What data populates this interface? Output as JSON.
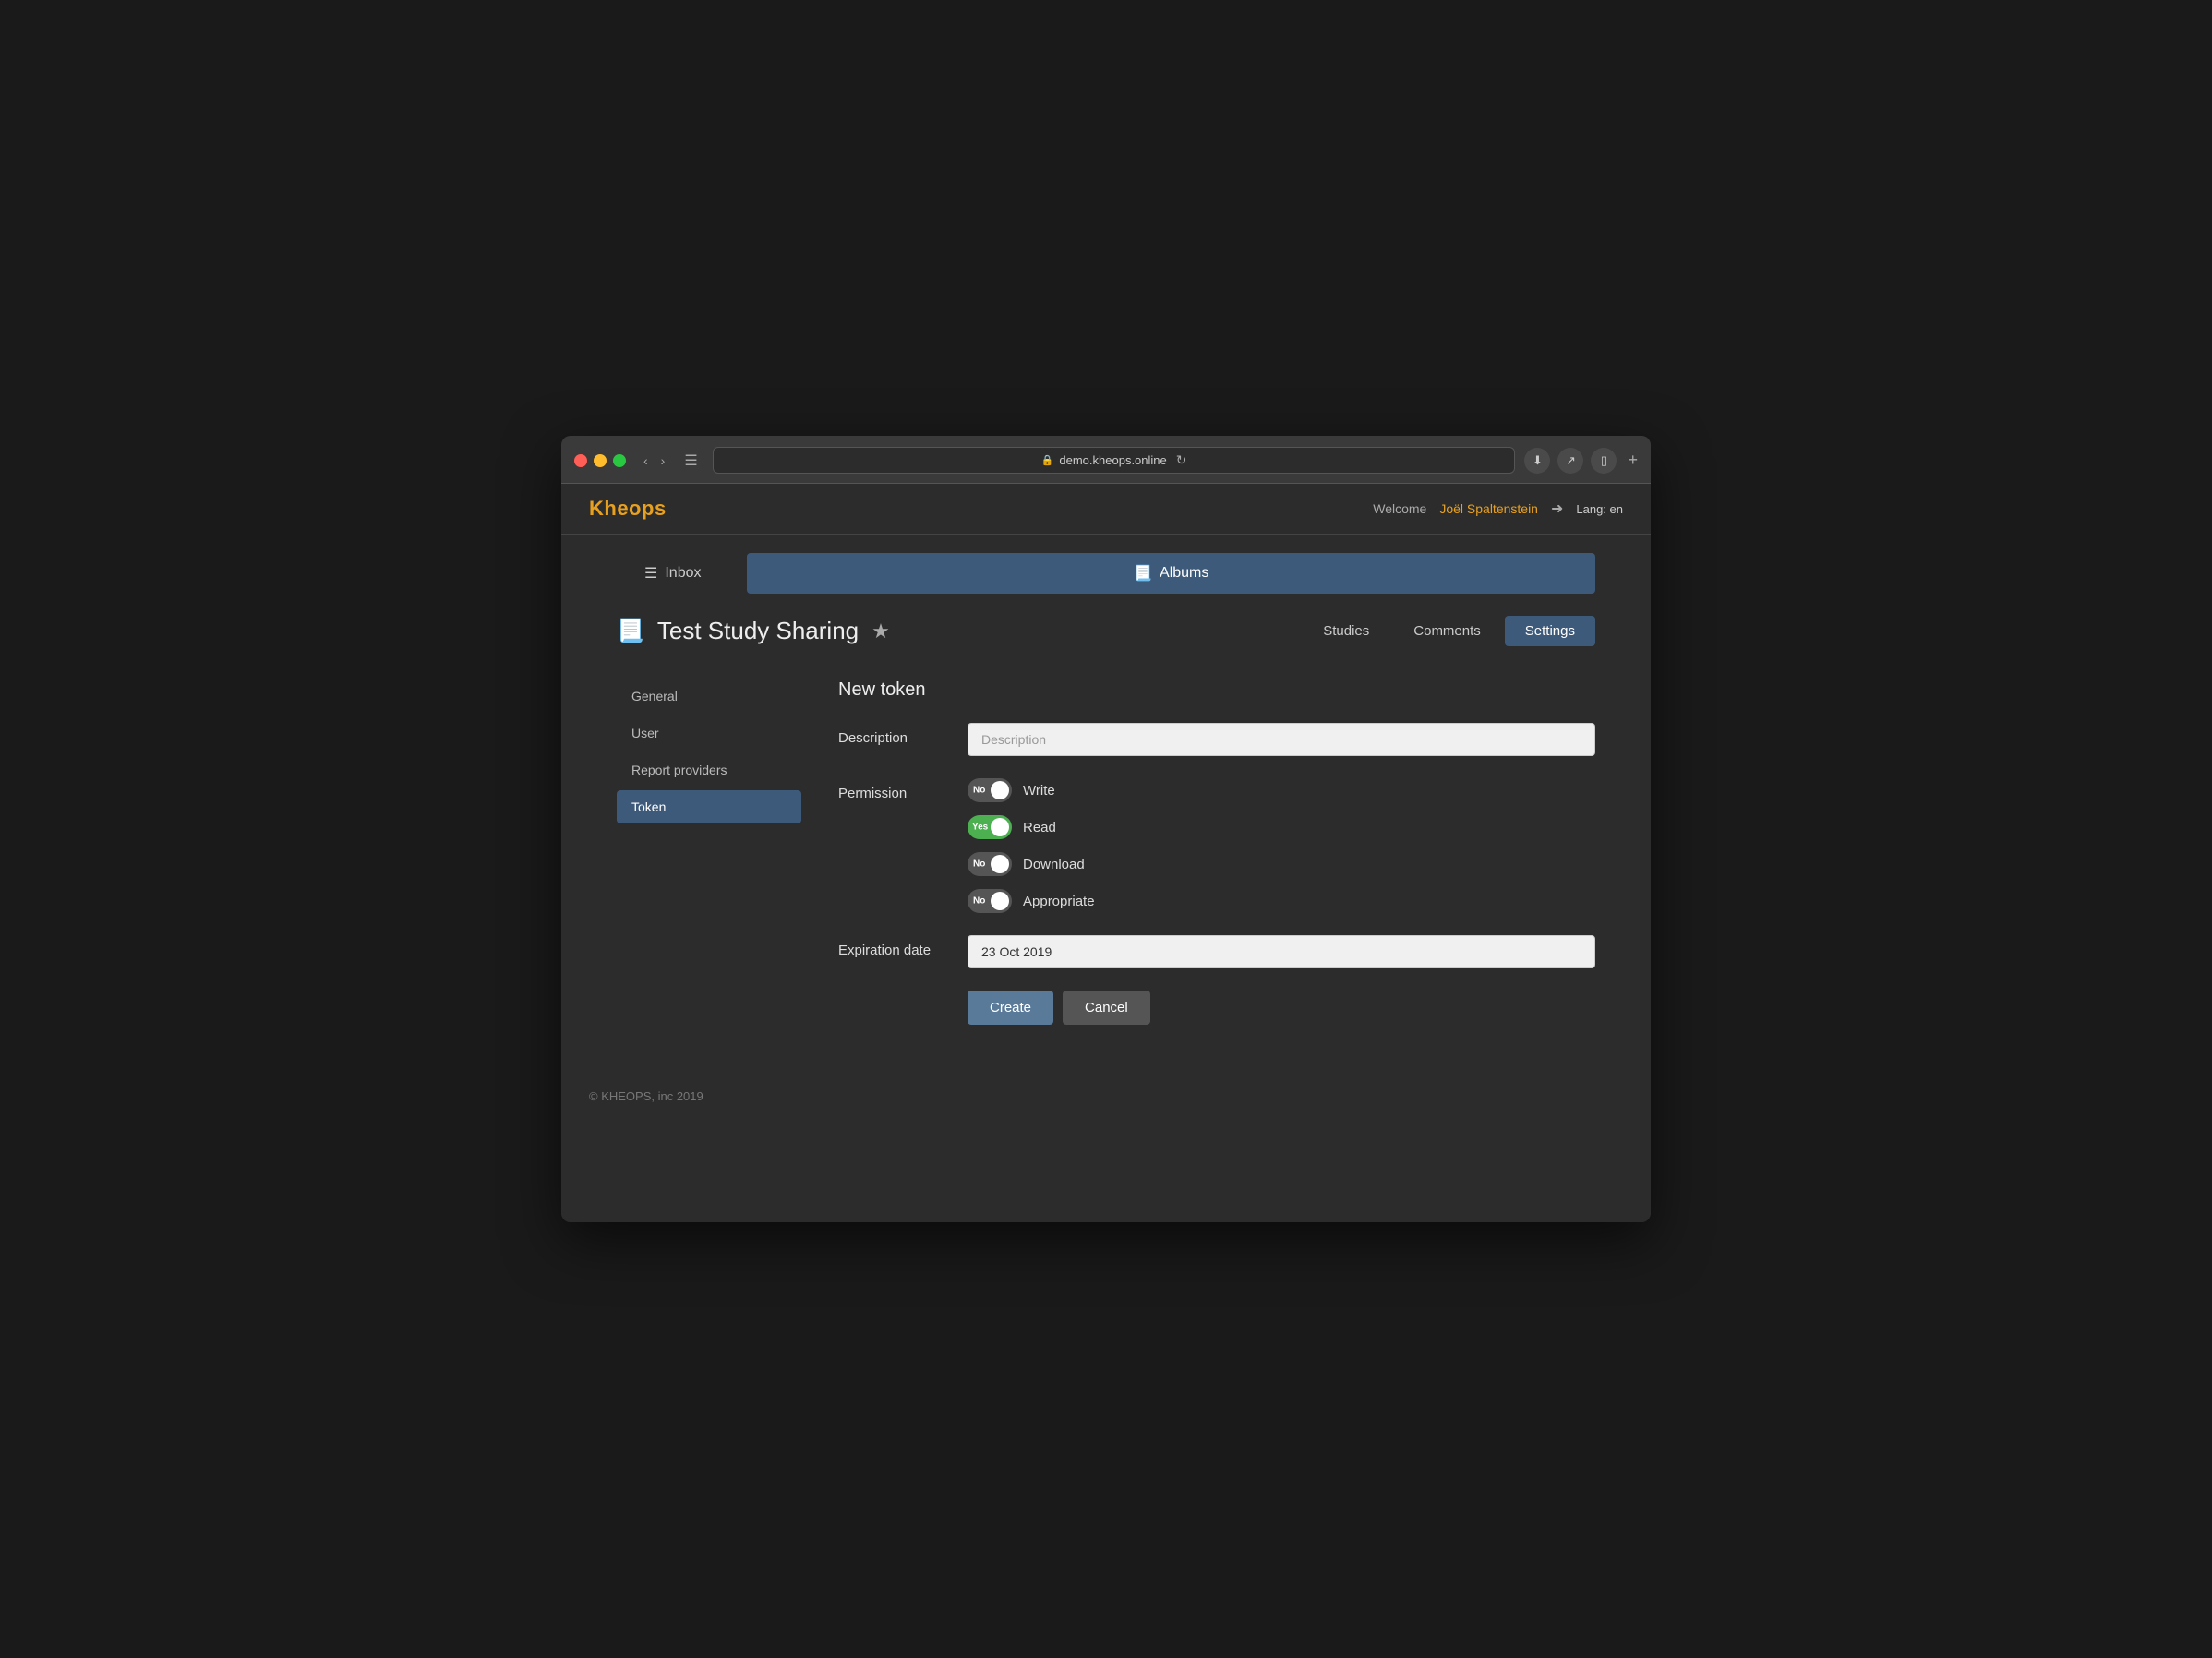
{
  "browser": {
    "url": "demo.kheops.online",
    "new_tab_label": "+"
  },
  "app": {
    "brand": "Kheops",
    "nav": {
      "welcome_text": "Welcome",
      "user_name": "Joël Spaltenstein",
      "lang_label": "Lang: en"
    },
    "tabs": [
      {
        "id": "inbox",
        "label": "Inbox",
        "active": false
      },
      {
        "id": "albums",
        "label": "Albums",
        "active": true
      }
    ],
    "study": {
      "title": "Test Study Sharing",
      "tabs": [
        {
          "id": "studies",
          "label": "Studies",
          "active": false
        },
        {
          "id": "comments",
          "label": "Comments",
          "active": false
        },
        {
          "id": "settings",
          "label": "Settings",
          "active": true
        }
      ]
    },
    "sidebar": {
      "items": [
        {
          "id": "general",
          "label": "General",
          "active": false
        },
        {
          "id": "user",
          "label": "User",
          "active": false
        },
        {
          "id": "report-providers",
          "label": "Report providers",
          "active": false
        },
        {
          "id": "token",
          "label": "Token",
          "active": true
        }
      ]
    },
    "new_token_form": {
      "title": "New token",
      "description_label": "Description",
      "description_placeholder": "Description",
      "permission_label": "Permission",
      "permissions": [
        {
          "id": "write",
          "label": "Write",
          "state": "off",
          "toggle_text": "No"
        },
        {
          "id": "read",
          "label": "Read",
          "state": "on",
          "toggle_text": "Yes"
        },
        {
          "id": "download",
          "label": "Download",
          "state": "off",
          "toggle_text": "No"
        },
        {
          "id": "appropriate",
          "label": "Appropriate",
          "state": "off",
          "toggle_text": "No"
        }
      ],
      "expiration_label": "Expiration date",
      "expiration_value": "23 Oct 2019",
      "create_button": "Create",
      "cancel_button": "Cancel"
    },
    "footer": {
      "copyright": "© KHEOPS, inc 2019"
    }
  }
}
